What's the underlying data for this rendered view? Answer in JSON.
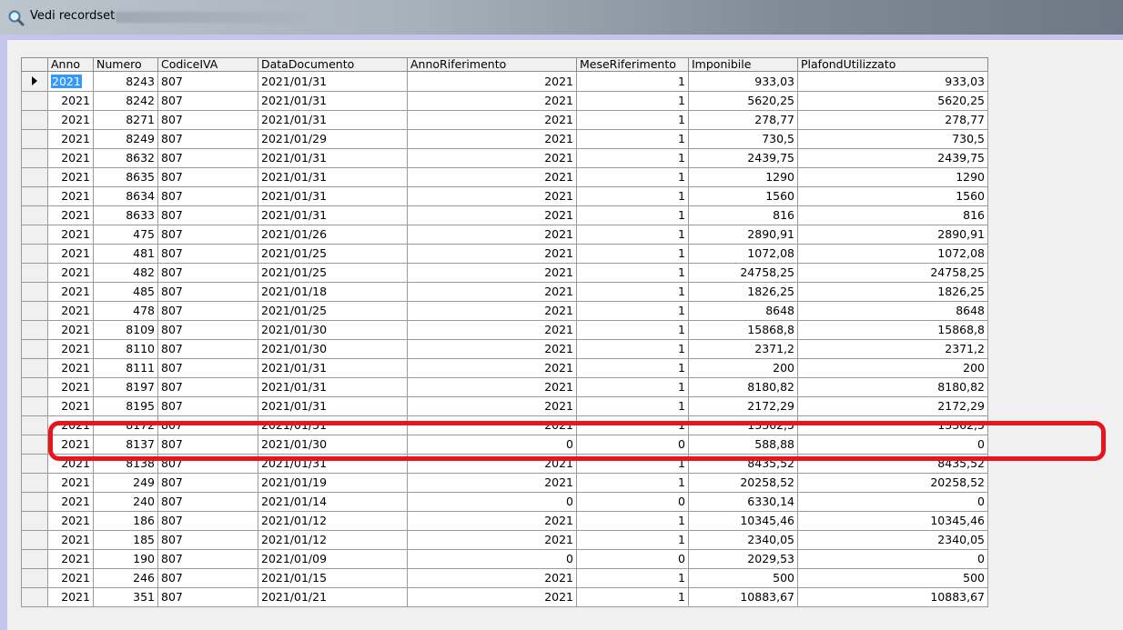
{
  "window": {
    "title": "Vedi recordset",
    "title_icon": "magnifier-icon"
  },
  "grid": {
    "columns": [
      "Anno",
      "Numero",
      "CodiceIVA",
      "DataDocumento",
      "AnnoRiferimento",
      "MeseRiferimento",
      "Imponibile",
      "PlafondUtilizzato"
    ],
    "rows": [
      [
        "2021",
        "8243",
        "807",
        "2021/01/31",
        "2021",
        "1",
        "933,03",
        "933,03"
      ],
      [
        "2021",
        "8242",
        "807",
        "2021/01/31",
        "2021",
        "1",
        "5620,25",
        "5620,25"
      ],
      [
        "2021",
        "8271",
        "807",
        "2021/01/31",
        "2021",
        "1",
        "278,77",
        "278,77"
      ],
      [
        "2021",
        "8249",
        "807",
        "2021/01/29",
        "2021",
        "1",
        "730,5",
        "730,5"
      ],
      [
        "2021",
        "8632",
        "807",
        "2021/01/31",
        "2021",
        "1",
        "2439,75",
        "2439,75"
      ],
      [
        "2021",
        "8635",
        "807",
        "2021/01/31",
        "2021",
        "1",
        "1290",
        "1290"
      ],
      [
        "2021",
        "8634",
        "807",
        "2021/01/31",
        "2021",
        "1",
        "1560",
        "1560"
      ],
      [
        "2021",
        "8633",
        "807",
        "2021/01/31",
        "2021",
        "1",
        "816",
        "816"
      ],
      [
        "2021",
        "475",
        "807",
        "2021/01/26",
        "2021",
        "1",
        "2890,91",
        "2890,91"
      ],
      [
        "2021",
        "481",
        "807",
        "2021/01/25",
        "2021",
        "1",
        "1072,08",
        "1072,08"
      ],
      [
        "2021",
        "482",
        "807",
        "2021/01/25",
        "2021",
        "1",
        "24758,25",
        "24758,25"
      ],
      [
        "2021",
        "485",
        "807",
        "2021/01/18",
        "2021",
        "1",
        "1826,25",
        "1826,25"
      ],
      [
        "2021",
        "478",
        "807",
        "2021/01/25",
        "2021",
        "1",
        "8648",
        "8648"
      ],
      [
        "2021",
        "8109",
        "807",
        "2021/01/30",
        "2021",
        "1",
        "15868,8",
        "15868,8"
      ],
      [
        "2021",
        "8110",
        "807",
        "2021/01/30",
        "2021",
        "1",
        "2371,2",
        "2371,2"
      ],
      [
        "2021",
        "8111",
        "807",
        "2021/01/31",
        "2021",
        "1",
        "200",
        "200"
      ],
      [
        "2021",
        "8197",
        "807",
        "2021/01/31",
        "2021",
        "1",
        "8180,82",
        "8180,82"
      ],
      [
        "2021",
        "8195",
        "807",
        "2021/01/31",
        "2021",
        "1",
        "2172,29",
        "2172,29"
      ],
      [
        "2021",
        "8172",
        "807",
        "2021/01/31",
        "2021",
        "1",
        "13362,5",
        "13362,5"
      ],
      [
        "2021",
        "8137",
        "807",
        "2021/01/30",
        "0",
        "0",
        "588,88",
        "0"
      ],
      [
        "2021",
        "8138",
        "807",
        "2021/01/31",
        "2021",
        "1",
        "8435,52",
        "8435,52"
      ],
      [
        "2021",
        "249",
        "807",
        "2021/01/19",
        "2021",
        "1",
        "20258,52",
        "20258,52"
      ],
      [
        "2021",
        "240",
        "807",
        "2021/01/14",
        "0",
        "0",
        "6330,14",
        "0"
      ],
      [
        "2021",
        "186",
        "807",
        "2021/01/12",
        "2021",
        "1",
        "10345,46",
        "10345,46"
      ],
      [
        "2021",
        "185",
        "807",
        "2021/01/12",
        "2021",
        "1",
        "2340,05",
        "2340,05"
      ],
      [
        "2021",
        "190",
        "807",
        "2021/01/09",
        "0",
        "0",
        "2029,53",
        "0"
      ],
      [
        "2021",
        "246",
        "807",
        "2021/01/15",
        "2021",
        "1",
        "500",
        "500"
      ],
      [
        "2021",
        "351",
        "807",
        "2021/01/21",
        "2021",
        "1",
        "10883,67",
        "10883,67"
      ]
    ],
    "current_row_indicator": "row-pointer-arrow-icon",
    "selected_cell_value": "2021",
    "annotation_color": "#e8161c"
  }
}
